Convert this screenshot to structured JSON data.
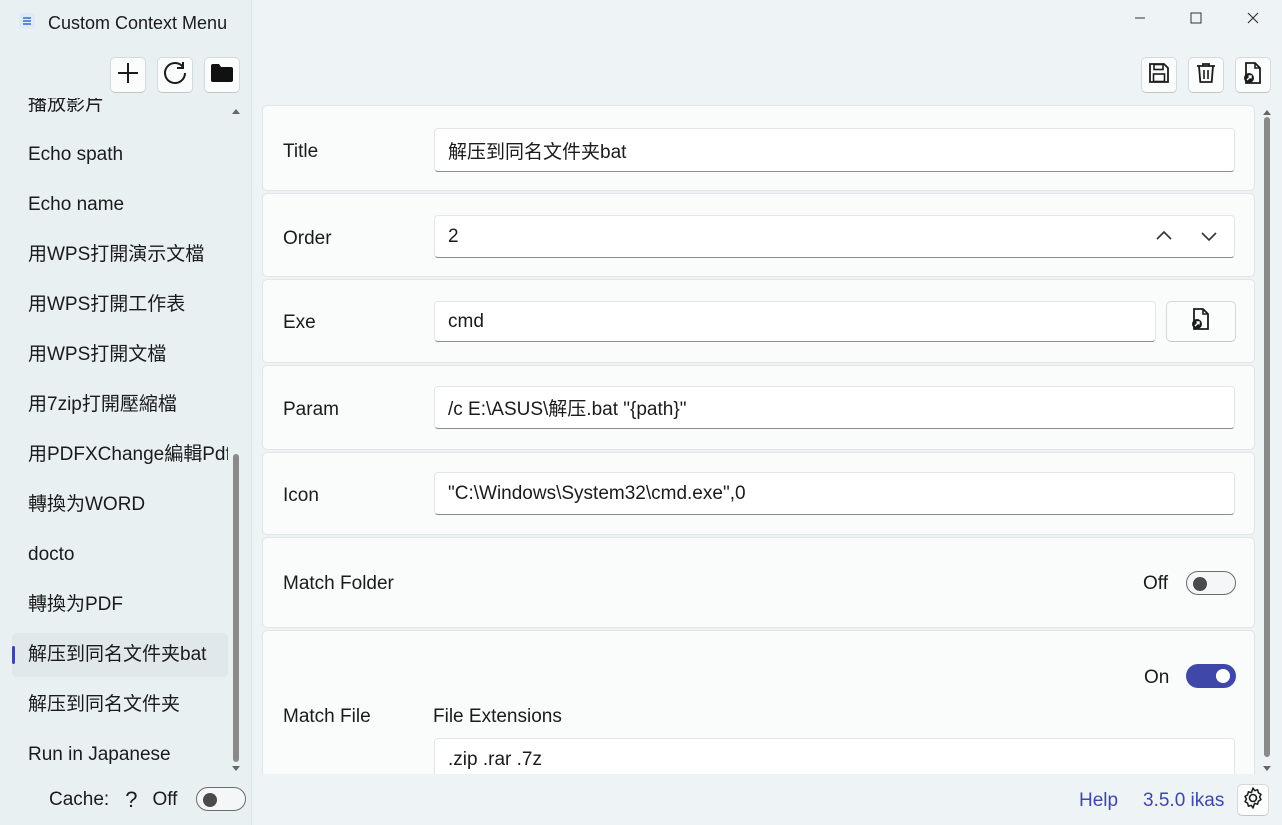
{
  "window": {
    "title": "Custom Context Menu",
    "controls": [
      "minimize-icon",
      "maximize-icon",
      "close-icon"
    ]
  },
  "sidebar": {
    "toolbar": [
      "add-icon",
      "refresh-icon",
      "folder-icon"
    ],
    "items": [
      {
        "label": "播放影片"
      },
      {
        "label": "Echo spath"
      },
      {
        "label": "Echo name"
      },
      {
        "label": "用WPS打開演示文檔"
      },
      {
        "label": "用WPS打開工作表"
      },
      {
        "label": "用WPS打開文檔"
      },
      {
        "label": "用7zip打開壓縮檔"
      },
      {
        "label": "用PDFXChange編輯Pdf"
      },
      {
        "label": "轉換为WORD"
      },
      {
        "label": "docto"
      },
      {
        "label": "轉換为PDF"
      },
      {
        "label": "解压到同名文件夹bat",
        "selected": true
      },
      {
        "label": "解压到同名文件夹"
      },
      {
        "label": "Run in Japanese"
      }
    ],
    "scroll_position": 0.55,
    "cache": {
      "label": "Cache:",
      "help": "?",
      "state_label": "Off",
      "on": false
    }
  },
  "editor": {
    "toolbar": [
      "save-icon",
      "delete-icon",
      "open-file-icon"
    ],
    "title": {
      "label": "Title",
      "value": "解压到同名文件夹bat"
    },
    "order": {
      "label": "Order",
      "value": "2"
    },
    "exe": {
      "label": "Exe",
      "value": "cmd"
    },
    "param": {
      "label": "Param",
      "value": "/c E:\\ASUS\\解压.bat \"{path}\""
    },
    "icon": {
      "label": "Icon",
      "value": "\"C:\\Windows\\System32\\cmd.exe\",0"
    },
    "match_folder": {
      "label": "Match Folder",
      "state_label": "Off",
      "on": false
    },
    "match_file": {
      "label": "Match File",
      "state_label": "On",
      "on": true,
      "extensions_label": "File Extensions",
      "extensions_value": ".zip .rar .7z"
    }
  },
  "footer": {
    "help": "Help",
    "version": "3.5.0 ikas",
    "settings": "gear-icon"
  },
  "colors": {
    "accent": "#3f48a9",
    "sidebar_bg": "#e9f0f2",
    "card_bg": "#fafbfb"
  }
}
